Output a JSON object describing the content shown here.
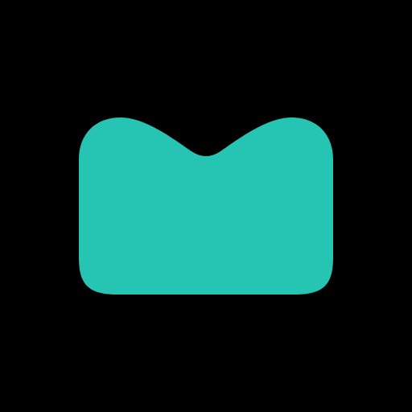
{
  "icon": {
    "name": "mail-envelope-icon",
    "fill_color": "#25C4B3",
    "background_color": "#000000"
  }
}
